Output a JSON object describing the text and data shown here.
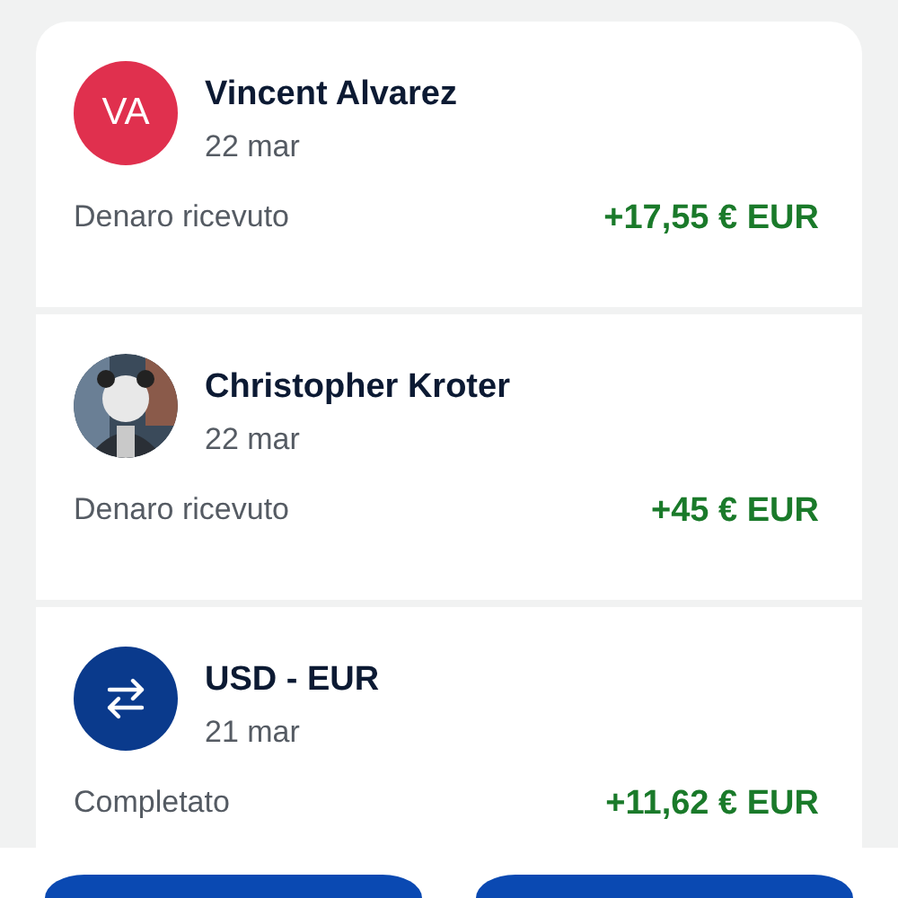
{
  "transactions": [
    {
      "avatar": {
        "kind": "initials",
        "text": "VA",
        "color": "#e0304e"
      },
      "name": "Vincent Alvarez",
      "date": "22 mar",
      "description": "Denaro ricevuto",
      "amount": "+17,55 € EUR"
    },
    {
      "name": "Christopher Kroter",
      "date": "22 mar",
      "description": "Denaro ricevuto",
      "amount": "+45 € EUR"
    },
    {
      "avatar": {
        "kind": "exchange",
        "color": "#0a3a8c"
      },
      "name": "USD - EUR",
      "date": "21 mar",
      "description": "Completato",
      "amount": "+11,62 € EUR"
    }
  ],
  "bottom_buttons": [
    {
      "kind": "button"
    },
    {
      "kind": "button"
    }
  ]
}
